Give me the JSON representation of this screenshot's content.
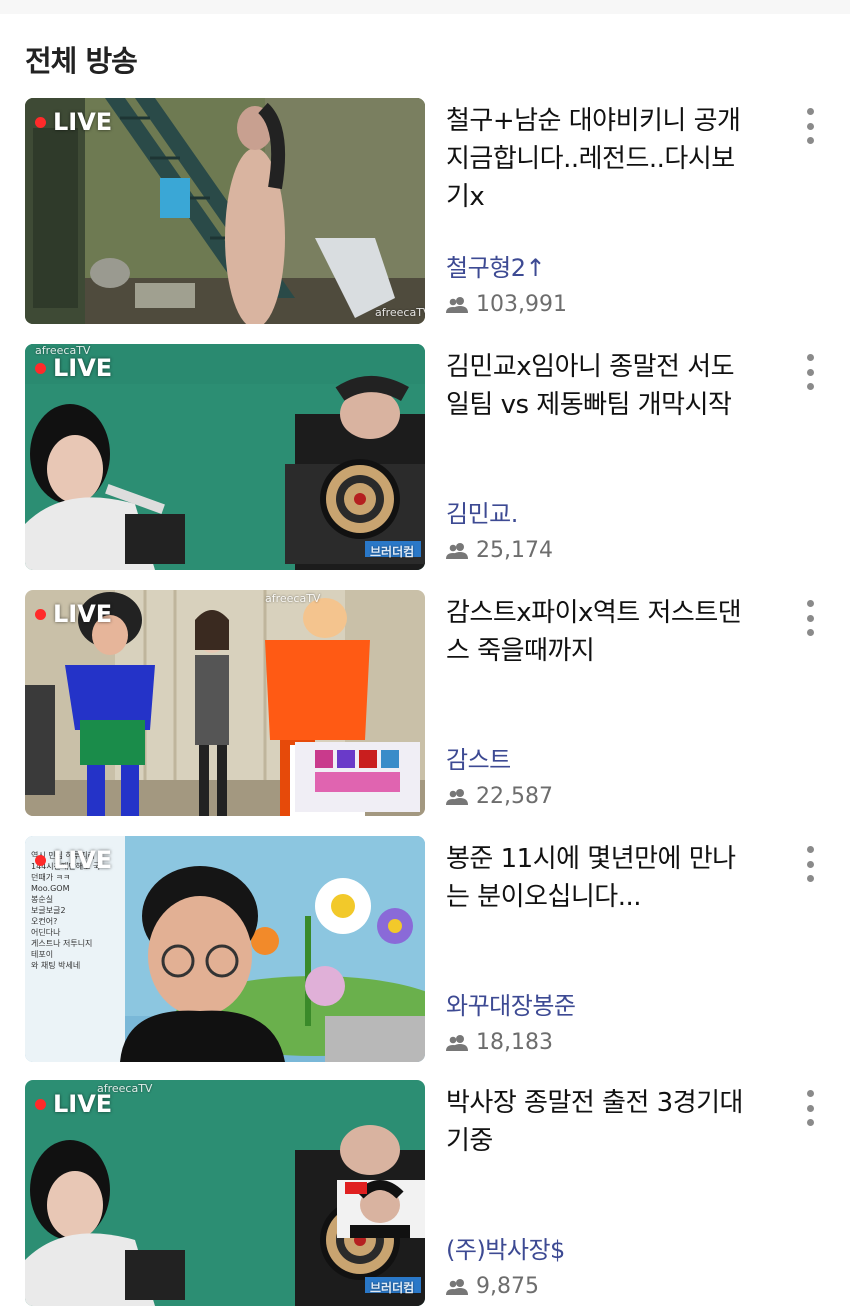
{
  "section_title": "전체 방송",
  "live_label": "LIVE",
  "platform_watermark": "afreecaTV",
  "items": [
    {
      "title": "철구+남순 대야비키니 공개\n지금합니다..레전드..다시보\n기x",
      "channel": "철구형2↑",
      "viewers": "103,991"
    },
    {
      "title": "김민교x임아니 종말전 서도\n일팀 vs 제동빠팀 개막시작",
      "channel": "김민교.",
      "viewers": "25,174",
      "overlay_text": "브러더컴"
    },
    {
      "title": "감스트x파이x역트 저스트댄\n스 죽을때까지",
      "channel": "감스트",
      "viewers": "22,587"
    },
    {
      "title": "봉준 11시에 몇년만에 만나\n는 분이오십니다...",
      "channel": "와꾸대장봉준",
      "viewers": "18,183",
      "chat_lines": [
        "역시 민심 하루피리",
        "144시간때만해도 국",
        "던때가 ㅋㅋ",
        "Moo.GOM",
        "봉순실",
        "보글보글2",
        "오컨어?",
        "어딘다나",
        "게스트나 저투니지",
        "테포이",
        "와 채팅 박세네"
      ]
    },
    {
      "title": "박사장 종말전 출전 3경기대\n기중",
      "channel": "(주)박사장$",
      "viewers": "9,875",
      "overlay_text": "브러더컴"
    }
  ],
  "colors": {
    "channel": "#3d4a93",
    "live_dot": "#ff2a2a",
    "meta": "#6d6d6d"
  },
  "icons": [
    "people-icon",
    "more-vert-icon"
  ]
}
